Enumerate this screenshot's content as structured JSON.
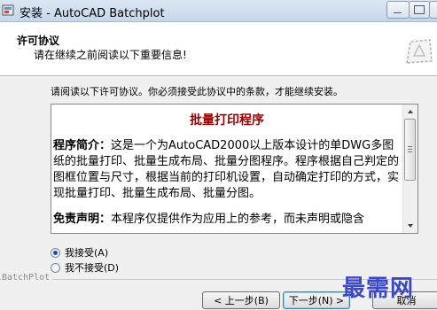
{
  "window": {
    "title": "安装 - AutoCAD Batchplot"
  },
  "header": {
    "title": "许可协议",
    "subtitle": "请在继续之前阅读以下重要信息!"
  },
  "instruction": "请阅读以下许可协议。你必须接受此协议中的条款，才能继续安装。",
  "license": {
    "heading": "批量打印程序",
    "intro_label": "程序简介：",
    "intro_text": "这是一个为AutoCAD2000以上版本设计的单DWG多图纸的批量打印、批量生成布局、批量分图程序。程序根据自己判定的图框位置与尺寸，根据当前的打印机设置，自动确定打印的方式，实现批量打印、批量生成布局、批量分图。",
    "disclaimer_label": "免责声明：",
    "disclaimer_text": "本程序仅提供作为应用上的参考，而未声明或隐含"
  },
  "options": {
    "accept_label": "我接受(A)",
    "decline_label": "我不接受(D)",
    "selected": "accept"
  },
  "brand": "BatchPlot",
  "buttons": {
    "back": "< 上一步(B)",
    "next": "下一步(N) >",
    "cancel": "取消"
  },
  "watermark": "最需网",
  "colors": {
    "heading": "#9a0000",
    "watermark": "#3d49c4"
  }
}
